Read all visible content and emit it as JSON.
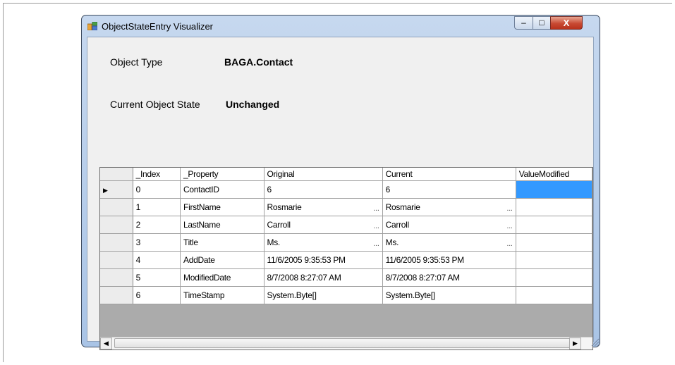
{
  "window": {
    "title": "ObjectStateEntry Visualizer",
    "controls": {
      "minimize": "–",
      "maximize": "□",
      "close": "X"
    }
  },
  "form": {
    "object_type_label": "Object Type",
    "object_type_value": "BAGA.Contact",
    "state_label": "Current Object State",
    "state_value": "Unchanged"
  },
  "grid": {
    "columns": [
      "_Index",
      "_Property",
      "Original",
      "Current",
      "ValueModified"
    ],
    "rows": [
      {
        "index": "0",
        "property": "ContactID",
        "original": "6",
        "current": "6",
        "ellipsis": false,
        "selected": true
      },
      {
        "index": "1",
        "property": "FirstName",
        "original": "Rosmarie",
        "current": "Rosmarie",
        "ellipsis": true
      },
      {
        "index": "2",
        "property": "LastName",
        "original": "Carroll",
        "current": "Carroll",
        "ellipsis": true
      },
      {
        "index": "3",
        "property": "Title",
        "original": "Ms.",
        "current": "Ms.",
        "ellipsis": true
      },
      {
        "index": "4",
        "property": "AddDate",
        "original": "11/6/2005 9:35:53 PM",
        "current": "11/6/2005 9:35:53 PM",
        "ellipsis": false
      },
      {
        "index": "5",
        "property": "ModifiedDate",
        "original": "8/7/2008 8:27:07 AM",
        "current": "8/7/2008 8:27:07 AM",
        "ellipsis": false
      },
      {
        "index": "6",
        "property": "TimeStamp",
        "original": "System.Byte[]",
        "current": "System.Byte[]",
        "ellipsis": false
      }
    ],
    "ellipsis_text": "...",
    "current_row_marker": "▶"
  },
  "colors": {
    "selection": "#3399ff",
    "empty_area": "#ababab",
    "window_frame": "#a9c4e6"
  }
}
